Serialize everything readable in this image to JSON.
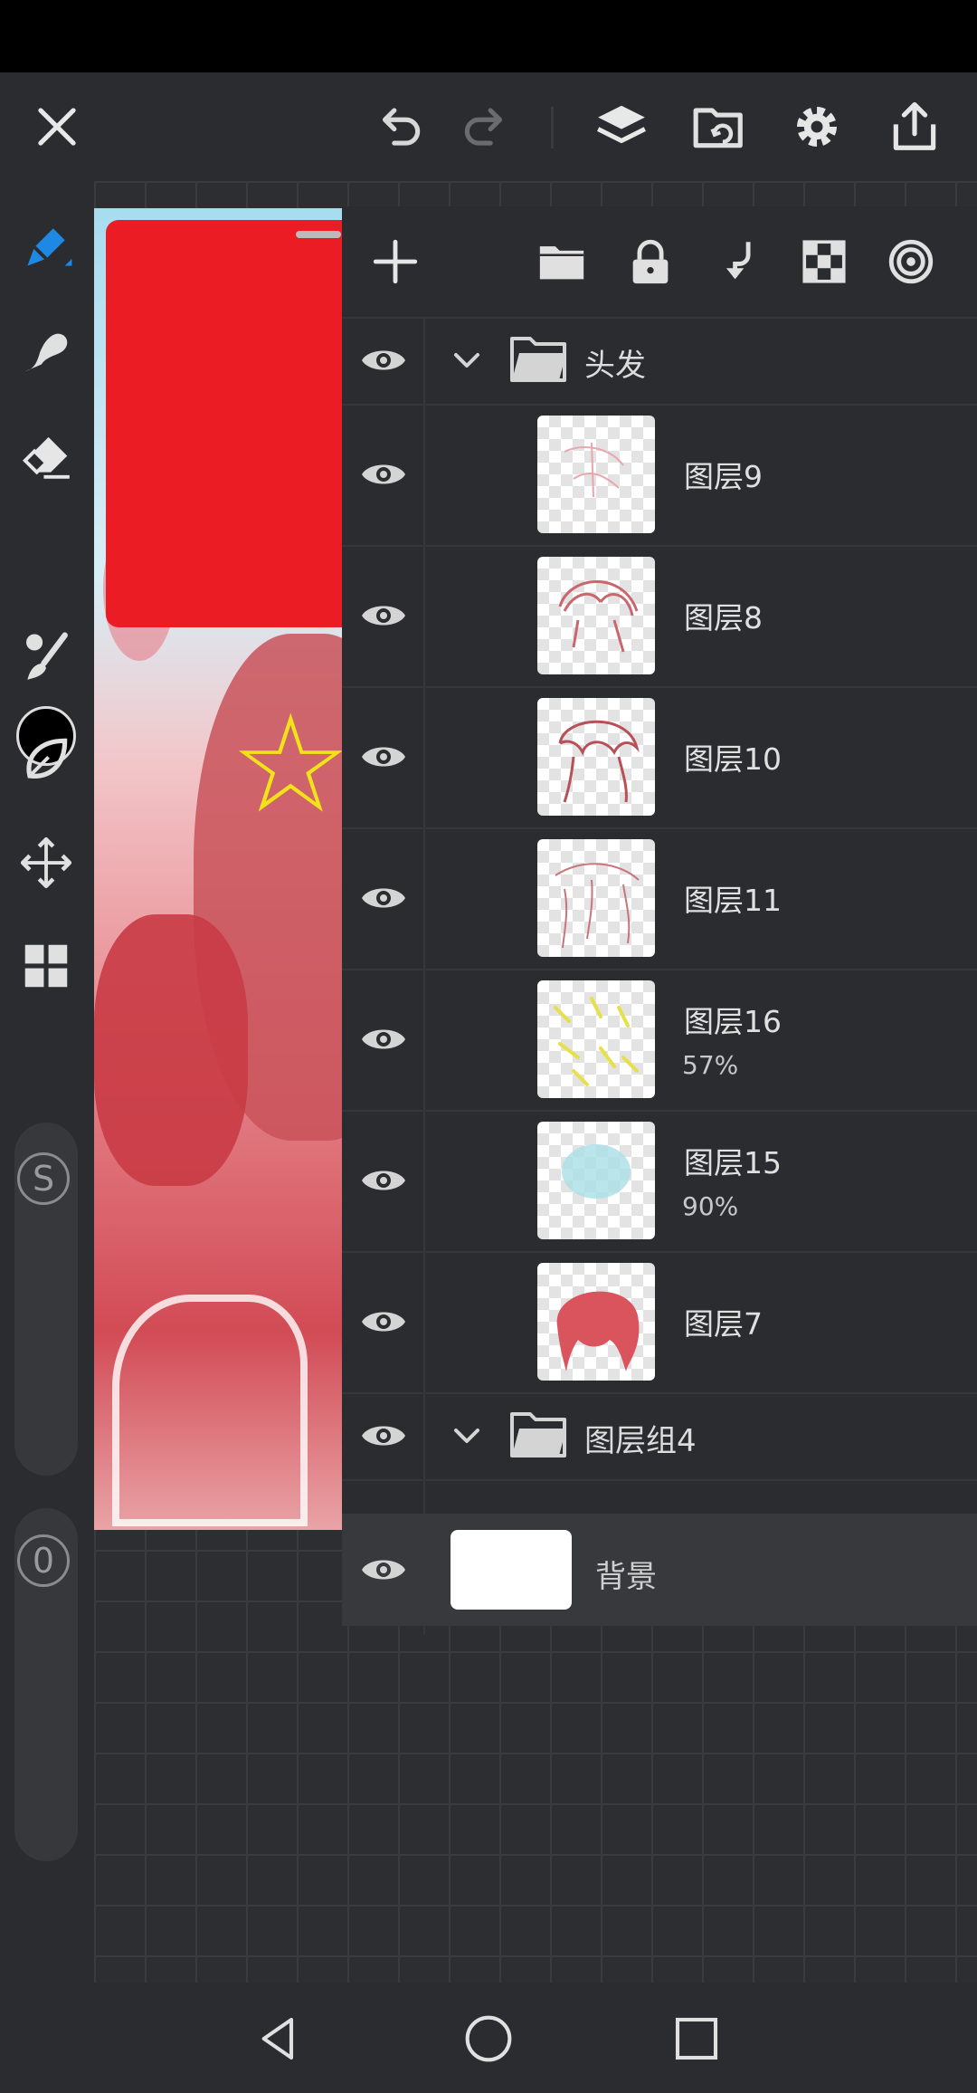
{
  "colors": {
    "accent": "#1e88e5",
    "current_color": "#000000",
    "panel_bg": "#2b2c2f"
  },
  "top_bar": {
    "icons": [
      "close-icon",
      "undo-icon",
      "redo-icon",
      "layers-icon",
      "import-icon",
      "settings-icon",
      "share-icon"
    ]
  },
  "left_toolbar": {
    "tools": [
      "pen-icon",
      "smudge-icon",
      "eraser-icon",
      "brush-icon",
      "lasso-icon",
      "move-icon",
      "grid-icon"
    ],
    "size_badge": "S",
    "opacity_badge": "0"
  },
  "layer_panel": {
    "toolbar": [
      "add-layer-icon",
      "new-folder-icon",
      "lock-icon",
      "merge-down-icon",
      "checker-icon",
      "blend-icon"
    ],
    "rows": [
      {
        "type": "group",
        "name": "头发"
      },
      {
        "type": "layer",
        "name": "图层9",
        "opacity": ""
      },
      {
        "type": "layer",
        "name": "图层8",
        "opacity": ""
      },
      {
        "type": "layer",
        "name": "图层10",
        "opacity": ""
      },
      {
        "type": "layer",
        "name": "图层11",
        "opacity": ""
      },
      {
        "type": "layer",
        "name": "图层16",
        "opacity": "57%"
      },
      {
        "type": "layer",
        "name": "图层15",
        "opacity": "90%"
      },
      {
        "type": "layer",
        "name": "图层7",
        "opacity": ""
      },
      {
        "type": "group",
        "name": "图层组4"
      }
    ],
    "background": {
      "name": "背景"
    }
  },
  "nav_bar": {
    "buttons": [
      "back-icon",
      "home-icon",
      "recents-icon"
    ]
  }
}
